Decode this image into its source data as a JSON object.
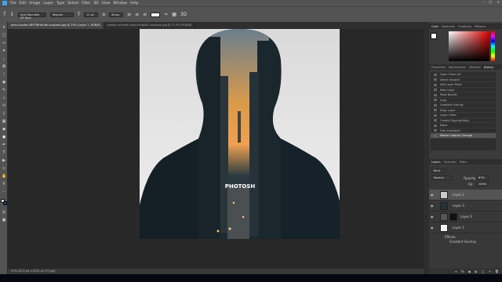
{
  "menubar": {
    "items": [
      "File",
      "Edit",
      "Image",
      "Layer",
      "Type",
      "Select",
      "Filter",
      "3D",
      "View",
      "Window",
      "Help"
    ]
  },
  "options": {
    "font": "Arial Rounded MT Bold",
    "style": "Regular",
    "size": "11 pt",
    "aa": "Sharp"
  },
  "tabs": [
    "amini-dudes-5BYT8tHeGdk-unsplash.jpg @ 25% (Layer 1, RGB/8)",
    "mattie-schmidt-uwlv/uYhq4cE-unsplash.jpg @ 12.5% (RGB/8)"
  ],
  "canvas": {
    "text": "PHOTOSH"
  },
  "status": "25%   4272 px x 4272 px (72 ppi)",
  "color_tabs": [
    "Color",
    "Swatches",
    "Gradients",
    "Patterns"
  ],
  "prop_tabs": [
    "Properties",
    "Adjustments",
    "Libraries",
    "History"
  ],
  "history": {
    "items": [
      "Open Clone Art",
      "Select Subject",
      "Add Layer Mask",
      "New Layer",
      "Paint Bucket",
      "Crop",
      "Gradient Overlay",
      "Drag Layer",
      "Layer Order",
      "Create Clipping Mask",
      "Move",
      "Free Transform",
      "Master Opacity Change"
    ]
  },
  "layers_tabs": [
    "Layers",
    "Channels",
    "Paths"
  ],
  "layers": {
    "kind": "Kind",
    "blend": "Normal",
    "opacity_label": "Opacity:",
    "opacity": "67%",
    "fill_label": "Fill:",
    "fill": "100%",
    "rows": [
      "Layer 2",
      "Layer 3",
      "Layer 0",
      "Layer 1"
    ],
    "effects": "Effects",
    "effect_item": "Gradient Overlay"
  },
  "colors": {
    "accent": "#31a8ff",
    "fg": "#ffffff",
    "bg": "#1e3a8a"
  }
}
